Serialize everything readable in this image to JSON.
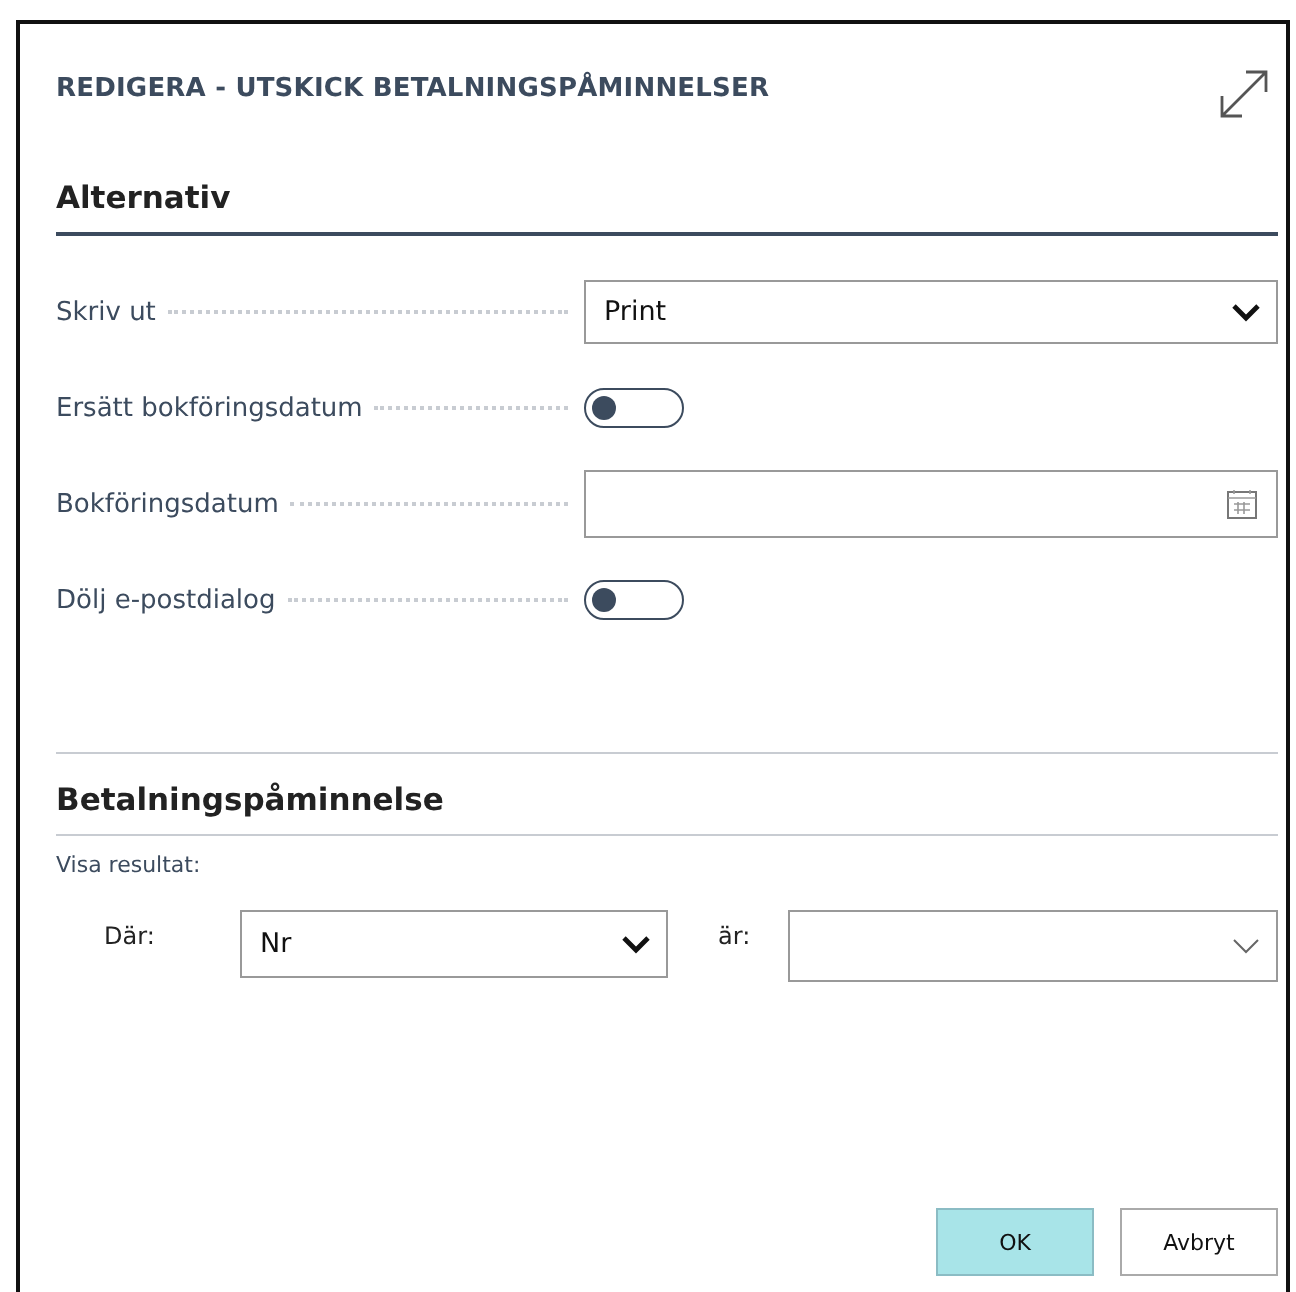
{
  "window": {
    "title": "REDIGERA - UTSKICK BETALNINGSPÅMINNELSER"
  },
  "options": {
    "heading": "Alternativ",
    "fields": [
      {
        "label": "Skriv ut",
        "kind": "select",
        "value": "Print"
      },
      {
        "label": "Ersätt bokföringsdatum",
        "kind": "toggle",
        "on": false
      },
      {
        "label": "Bokföringsdatum",
        "kind": "date"
      },
      {
        "label": "Dölj e-postdialog",
        "kind": "toggle",
        "on": false
      }
    ]
  },
  "filter_section": {
    "heading": "Betalningspåminnelse",
    "caption": "Visa resultat:",
    "where_label": "Där:",
    "where_value": "Nr",
    "is_label": "är:"
  },
  "buttons": [
    {
      "label": "OK",
      "primary": true
    },
    {
      "label": "Avbryt",
      "primary": false
    }
  ]
}
